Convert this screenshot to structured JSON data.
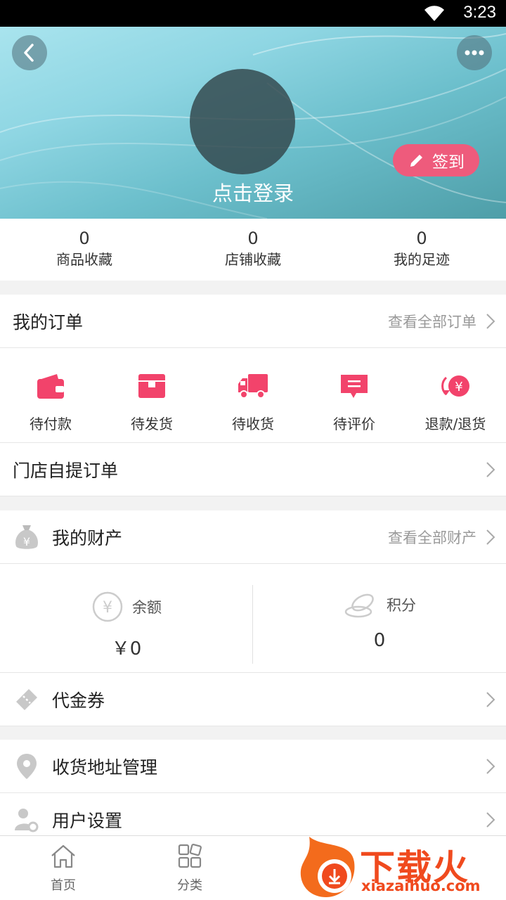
{
  "status_bar": {
    "time": "3:23"
  },
  "header": {
    "login_label": "点击登录",
    "checkin_label": "签到"
  },
  "stats": [
    {
      "value": "0",
      "label": "商品收藏"
    },
    {
      "value": "0",
      "label": "店铺收藏"
    },
    {
      "value": "0",
      "label": "我的足迹"
    }
  ],
  "orders": {
    "title": "我的订单",
    "view_all": "查看全部订单",
    "items": [
      {
        "label": "待付款",
        "icon": "wallet-icon"
      },
      {
        "label": "待发货",
        "icon": "package-icon"
      },
      {
        "label": "待收货",
        "icon": "truck-icon"
      },
      {
        "label": "待评价",
        "icon": "comment-icon"
      },
      {
        "label": "退款/退货",
        "icon": "refund-icon"
      }
    ],
    "accent_color": "#f2436b"
  },
  "store_pickup": {
    "title": "门店自提订单"
  },
  "assets": {
    "title": "我的财产",
    "view_all": "查看全部财产",
    "balance_label": "余额",
    "balance_value": "￥0",
    "points_label": "积分",
    "points_value": "0"
  },
  "coupons": {
    "title": "代金券"
  },
  "address": {
    "title": "收货地址管理"
  },
  "settings": {
    "title": "用户设置"
  },
  "tabbar": [
    {
      "label": "首页",
      "icon": "home-icon"
    },
    {
      "label": "分类",
      "icon": "grid-icon"
    }
  ],
  "watermark": {
    "brand": "下载火",
    "url": "xiazaihuo.com"
  }
}
